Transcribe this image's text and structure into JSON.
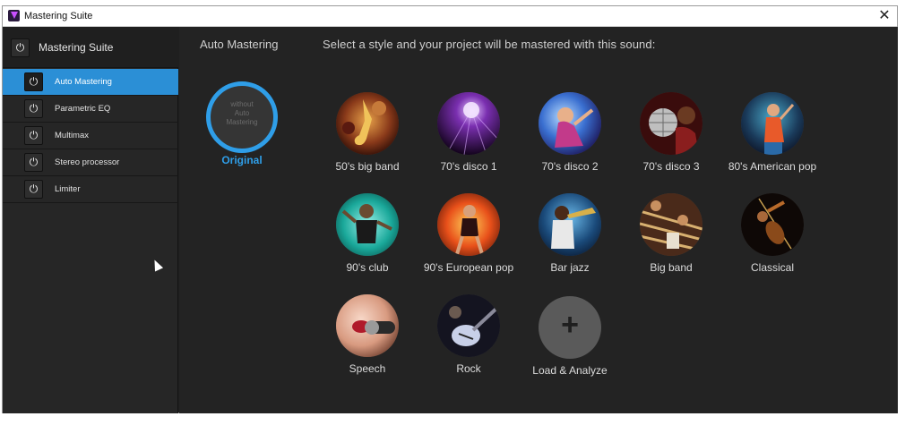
{
  "window": {
    "title": "Mastering Suite",
    "close_glyph": "✕"
  },
  "sidebar": {
    "header": {
      "label": "Mastering Suite",
      "icon": "power-icon"
    },
    "items": [
      {
        "label": "Auto Mastering",
        "active": true
      },
      {
        "label": "Parametric EQ",
        "active": false
      },
      {
        "label": "Multimax",
        "active": false
      },
      {
        "label": "Stereo processor",
        "active": false
      },
      {
        "label": "Limiter",
        "active": false
      }
    ],
    "power_glyph": "⏻"
  },
  "main": {
    "heading": "Auto Mastering",
    "instruction": "Select a style and your project will be mastered with this sound:",
    "original": {
      "inner_line1": "without",
      "inner_line2": "Auto",
      "inner_line3": "Mastering",
      "label": "Original"
    },
    "styles": [
      {
        "label": "50's big band",
        "icon": "saxophone-image"
      },
      {
        "label": "70's disco 1",
        "icon": "disco-lights-image"
      },
      {
        "label": "70's disco 2",
        "icon": "disco-dancer-image"
      },
      {
        "label": "70's disco 3",
        "icon": "disco-ball-image"
      },
      {
        "label": "80's American pop",
        "icon": "pop-singer-image"
      },
      {
        "label": "90's club",
        "icon": "club-dancer-image"
      },
      {
        "label": "90's European pop",
        "icon": "fire-dancer-image"
      },
      {
        "label": "Bar jazz",
        "icon": "trumpet-image"
      },
      {
        "label": "Big band",
        "icon": "brass-section-image"
      },
      {
        "label": "Classical",
        "icon": "violin-image"
      },
      {
        "label": "Speech",
        "icon": "microphone-image"
      },
      {
        "label": "Rock",
        "icon": "electric-guitar-image"
      }
    ],
    "load": {
      "label": "Load & Analyze",
      "glyph": "+"
    }
  },
  "colors": {
    "accent": "#2b8fd6",
    "original_ring": "#2f9ee8",
    "background": "#232323"
  }
}
